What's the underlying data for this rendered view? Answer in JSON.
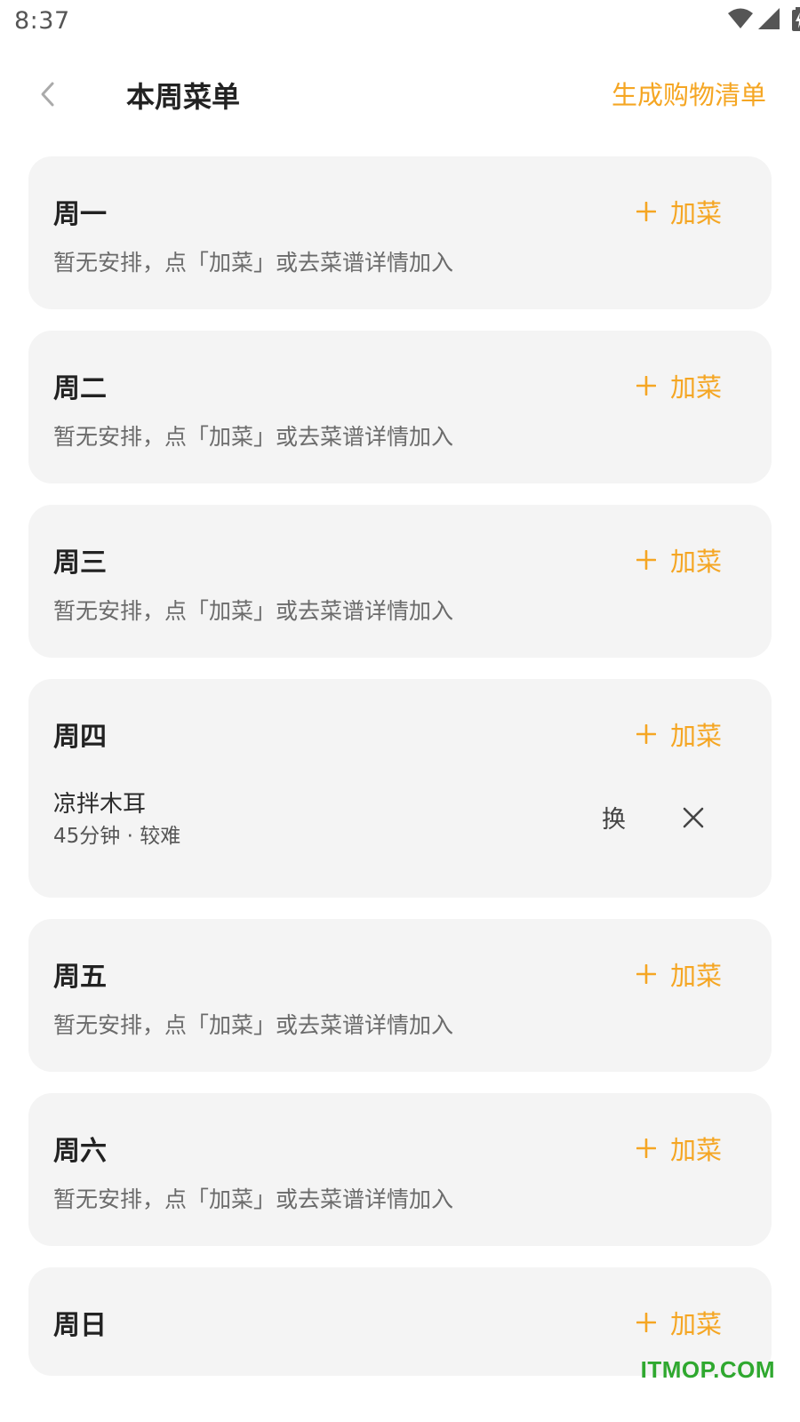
{
  "status_bar": {
    "time": "8:37"
  },
  "header": {
    "title": "本周菜单",
    "action": "生成购物清单"
  },
  "add_label": "加菜",
  "empty_hint": "暂无安排，点「加菜」或去菜谱详情加入",
  "days": [
    {
      "label": "周一"
    },
    {
      "label": "周二"
    },
    {
      "label": "周三"
    },
    {
      "label": "周四",
      "dish": {
        "name": "凉拌木耳",
        "meta": "45分钟 · 较难",
        "swap": "换"
      }
    },
    {
      "label": "周五"
    },
    {
      "label": "周六"
    },
    {
      "label": "周日"
    }
  ],
  "watermark": "ITMOP.COM",
  "colors": {
    "accent": "#f5a623",
    "card_bg": "#f4f4f4",
    "watermark": "#2fa82f"
  }
}
